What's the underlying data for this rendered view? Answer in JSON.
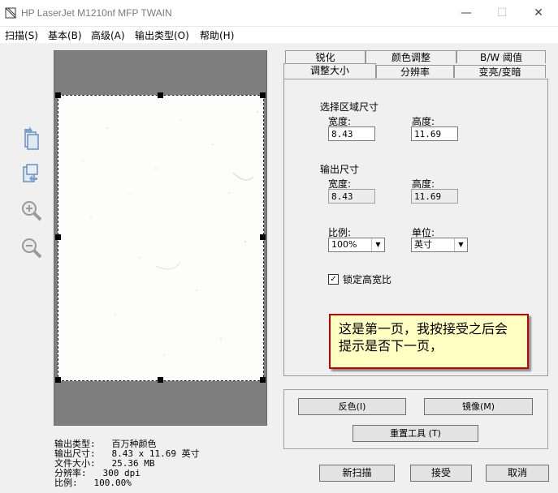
{
  "window": {
    "title": "HP LaserJet M1210nf MFP TWAIN",
    "minimize": "—",
    "maximize": "☐",
    "close": "✕"
  },
  "menu": [
    "扫描(S)",
    "基本(B)",
    "高级(A)",
    "输出类型(O)",
    "帮助(H)"
  ],
  "tabs": {
    "row_top": [
      "锐化",
      "颜色调整",
      "B/W 阈值"
    ],
    "row_bottom": [
      "调整大小",
      "分辨率",
      "变亮/变暗"
    ],
    "active": "调整大小"
  },
  "resize_panel": {
    "selection_title": "选择区域尺寸",
    "width_label": "宽度:",
    "height_label": "高度:",
    "sel_width": "8.43",
    "sel_height": "11.69",
    "output_title": "输出尺寸",
    "out_width": "8.43",
    "out_height": "11.69",
    "scale_label": "比例:",
    "scale_value": "100%",
    "unit_label": "单位:",
    "unit_value": "英寸",
    "lock_label": "锁定高宽比",
    "lock_checked": "✓"
  },
  "callout": {
    "text_line1": "这是第一页，我按接受之后会",
    "text_line2": "提示是否下一页，"
  },
  "buttons": {
    "invert": "反色(I)",
    "mirror": "镜像(M)",
    "reset": "重置工具 (T)",
    "new_scan": "新扫描",
    "accept": "接受",
    "cancel": "取消"
  },
  "status": {
    "output_type": "输出类型:   百万种颜色",
    "output_size": "输出尺寸:   8.43 x 11.69 英寸",
    "file_size": "文件大小:   25.36 MB",
    "resolution": "分辨率:   300 dpi",
    "scale": "比例:   100.00%"
  },
  "colors": {
    "callout_border": "#c00000",
    "callout_bg": "#ffffc4",
    "preview_bg": "#7f7f7f"
  }
}
